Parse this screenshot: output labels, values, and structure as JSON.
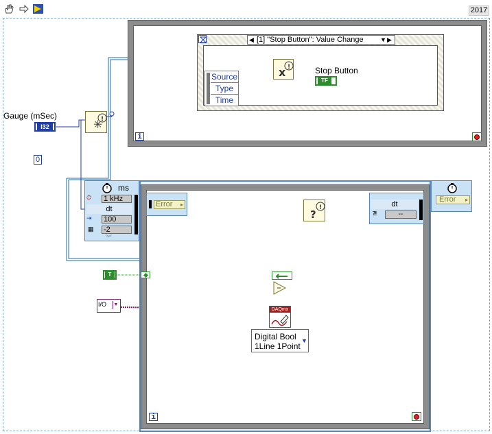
{
  "toolbar": {
    "icons": [
      "hand-tool-icon",
      "step-arrow-icon",
      "run-continuously-icon"
    ],
    "version": "2017"
  },
  "controls": {
    "gauge_label": "Gauge (mSec)",
    "gauge_type": "I32",
    "gauge_value": "0",
    "bool_constant": "T",
    "io_constant": "I/O"
  },
  "event_structure": {
    "case_label": "[1] \"Stop Button\": Value Change",
    "event_data": [
      "Source",
      "Type",
      "Time"
    ],
    "stop_button_label": "Stop Button",
    "stop_button_type": "TF",
    "iteration_symbol": "i"
  },
  "timed_loop": {
    "input_node_units": "ms",
    "input_rows": [
      "1 kHz",
      "dt",
      "100",
      "-2"
    ],
    "error_label": "Error",
    "output_node_rows": [
      "dt",
      "--"
    ],
    "output_error_label": "Error",
    "iteration_symbol": "i"
  },
  "daqmx": {
    "vi_label": "DAQmx",
    "selector_line1": "Digital Bool",
    "selector_line2": "1Line 1Point"
  },
  "colors": {
    "wire_cluster": "#1b6fa8",
    "wire_blue": "#1f3ea8",
    "wire_bool": "#2e8b2e",
    "wire_io": "#7a1e6f",
    "wire_error": "#b8a800",
    "frame_gray": "#8c8c8c"
  }
}
